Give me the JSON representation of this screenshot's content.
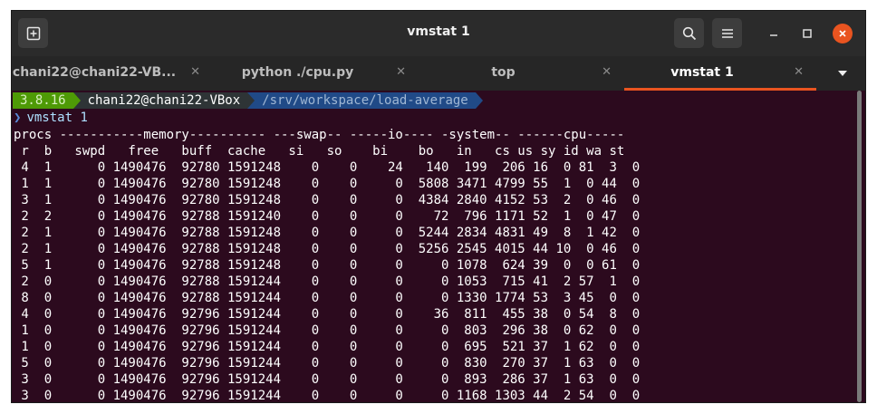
{
  "window": {
    "title": "vmstat 1"
  },
  "tabs": [
    {
      "label": "chani22@chani22-VB...",
      "active": false
    },
    {
      "label": "python ./cpu.py",
      "active": false
    },
    {
      "label": "top",
      "active": false
    },
    {
      "label": "vmstat 1",
      "active": true
    }
  ],
  "prompt": {
    "python_version": "3.8.16",
    "user_host": "chani22@chani22-VBox",
    "cwd": "/srv/workspace/load-average"
  },
  "command": {
    "symbol": "❯",
    "text": "vmstat 1"
  },
  "vmstat": {
    "header1": "procs -----------memory---------- ---swap-- -----io---- -system-- ------cpu-----",
    "header2": " r  b   swpd   free   buff  cache   si   so    bi    bo   in   cs us sy id wa st",
    "rows": [
      " 4  1      0 1490476  92780 1591248    0    0    24   140  199  206 16  0 81  3  0",
      " 1  1      0 1490476  92780 1591248    0    0     0  5808 3471 4799 55  1  0 44  0",
      " 3  1      0 1490476  92780 1591248    0    0     0  4384 2840 4152 53  2  0 46  0",
      " 2  2      0 1490476  92788 1591240    0    0     0    72  796 1171 52  1  0 47  0",
      " 2  1      0 1490476  92788 1591248    0    0     0  5244 2834 4831 49  8  1 42  0",
      " 2  1      0 1490476  92788 1591248    0    0     0  5256 2545 4015 44 10  0 46  0",
      " 5  1      0 1490476  92788 1591248    0    0     0     0 1078  624 39  0  0 61  0",
      " 2  0      0 1490476  92788 1591244    0    0     0     0 1053  715 41  2 57  1  0",
      " 8  0      0 1490476  92788 1591244    0    0     0     0 1330 1774 53  3 45  0  0",
      " 4  0      0 1490476  92796 1591244    0    0     0    36  811  455 38  0 54  8  0",
      " 1  0      0 1490476  92796 1591244    0    0     0     0  803  296 38  0 62  0  0",
      " 1  0      0 1490476  92796 1591244    0    0     0     0  695  521 37  1 62  0  0",
      " 5  0      0 1490476  92796 1591244    0    0     0     0  830  270 37  1 63  0  0",
      " 3  0      0 1490476  92796 1591244    0    0     0     0  893  286 37  1 63  0  0",
      " 3  0      0 1490476  92796 1591244    0    0     0     0 1168 1303 44  2 54  0  0"
    ]
  },
  "colors": {
    "terminal_bg": "#2c0a1e",
    "accent": "#e95420",
    "python_segment": "#4e9a06",
    "dir_segment": "#204a87"
  },
  "icons": [
    "new-tab-icon",
    "search-icon",
    "hamburger-menu-icon",
    "minimize-icon",
    "maximize-icon",
    "close-icon",
    "tab-close-icon",
    "tabs-dropdown-icon"
  ]
}
